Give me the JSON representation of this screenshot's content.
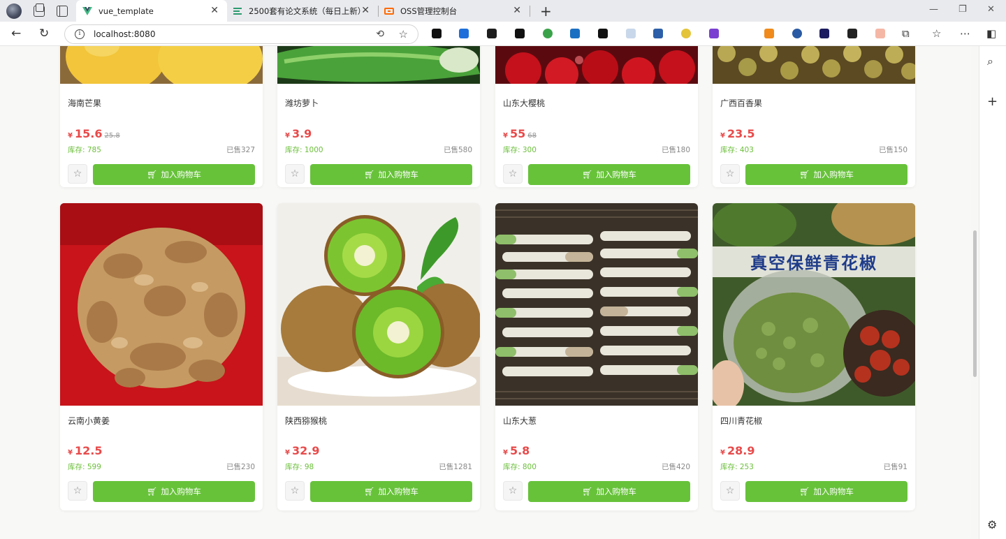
{
  "browser": {
    "tabs": [
      {
        "title": "vue_template",
        "active": true
      },
      {
        "title": "2500套有论文系统（每日上新）",
        "active": false
      },
      {
        "title": "OSS管理控制台",
        "active": false
      }
    ],
    "url": "localhost:8080"
  },
  "products_top": [
    {
      "name": "海南芒果",
      "price": "15.6",
      "original_price": "25.8",
      "stock": "库存: 785",
      "sold": "已售327"
    },
    {
      "name": "潍坊萝卜",
      "price": "3.9",
      "original_price": "",
      "stock": "库存: 1000",
      "sold": "已售580"
    },
    {
      "name": "山东大樱桃",
      "price": "55",
      "original_price": "68",
      "stock": "库存: 300",
      "sold": "已售180"
    },
    {
      "name": "广西百香果",
      "price": "23.5",
      "original_price": "",
      "stock": "库存: 403",
      "sold": "已售150"
    }
  ],
  "products_bottom": [
    {
      "name": "云南小黄姜",
      "price": "12.5",
      "original_price": "",
      "stock": "库存: 599",
      "sold": "已售230"
    },
    {
      "name": "陕西猕猴桃",
      "price": "32.9",
      "original_price": "",
      "stock": "库存: 98",
      "sold": "已售1281"
    },
    {
      "name": "山东大葱",
      "price": "5.8",
      "original_price": "",
      "stock": "库存: 800",
      "sold": "已售420"
    },
    {
      "name": "四川青花椒",
      "price": "28.9",
      "original_price": "",
      "stock": "库存: 253",
      "sold": "已售91"
    }
  ],
  "currency_symbol": "¥",
  "add_to_cart_label": "加入购物车",
  "image_overlay_text": "真空保鲜青花椒",
  "colors": {
    "price": "#e84a4a",
    "stock": "#6bbf3a",
    "button": "#67c23a"
  }
}
